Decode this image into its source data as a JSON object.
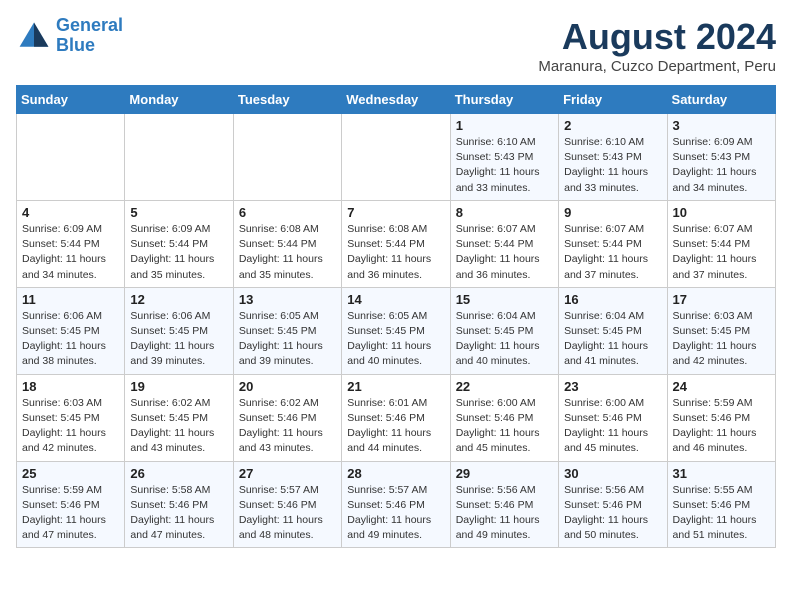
{
  "header": {
    "logo_line1": "General",
    "logo_line2": "Blue",
    "month": "August 2024",
    "location": "Maranura, Cuzco Department, Peru"
  },
  "days_of_week": [
    "Sunday",
    "Monday",
    "Tuesday",
    "Wednesday",
    "Thursday",
    "Friday",
    "Saturday"
  ],
  "weeks": [
    [
      {
        "day": "",
        "info": ""
      },
      {
        "day": "",
        "info": ""
      },
      {
        "day": "",
        "info": ""
      },
      {
        "day": "",
        "info": ""
      },
      {
        "day": "1",
        "info": "Sunrise: 6:10 AM\nSunset: 5:43 PM\nDaylight: 11 hours\nand 33 minutes."
      },
      {
        "day": "2",
        "info": "Sunrise: 6:10 AM\nSunset: 5:43 PM\nDaylight: 11 hours\nand 33 minutes."
      },
      {
        "day": "3",
        "info": "Sunrise: 6:09 AM\nSunset: 5:43 PM\nDaylight: 11 hours\nand 34 minutes."
      }
    ],
    [
      {
        "day": "4",
        "info": "Sunrise: 6:09 AM\nSunset: 5:44 PM\nDaylight: 11 hours\nand 34 minutes."
      },
      {
        "day": "5",
        "info": "Sunrise: 6:09 AM\nSunset: 5:44 PM\nDaylight: 11 hours\nand 35 minutes."
      },
      {
        "day": "6",
        "info": "Sunrise: 6:08 AM\nSunset: 5:44 PM\nDaylight: 11 hours\nand 35 minutes."
      },
      {
        "day": "7",
        "info": "Sunrise: 6:08 AM\nSunset: 5:44 PM\nDaylight: 11 hours\nand 36 minutes."
      },
      {
        "day": "8",
        "info": "Sunrise: 6:07 AM\nSunset: 5:44 PM\nDaylight: 11 hours\nand 36 minutes."
      },
      {
        "day": "9",
        "info": "Sunrise: 6:07 AM\nSunset: 5:44 PM\nDaylight: 11 hours\nand 37 minutes."
      },
      {
        "day": "10",
        "info": "Sunrise: 6:07 AM\nSunset: 5:44 PM\nDaylight: 11 hours\nand 37 minutes."
      }
    ],
    [
      {
        "day": "11",
        "info": "Sunrise: 6:06 AM\nSunset: 5:45 PM\nDaylight: 11 hours\nand 38 minutes."
      },
      {
        "day": "12",
        "info": "Sunrise: 6:06 AM\nSunset: 5:45 PM\nDaylight: 11 hours\nand 39 minutes."
      },
      {
        "day": "13",
        "info": "Sunrise: 6:05 AM\nSunset: 5:45 PM\nDaylight: 11 hours\nand 39 minutes."
      },
      {
        "day": "14",
        "info": "Sunrise: 6:05 AM\nSunset: 5:45 PM\nDaylight: 11 hours\nand 40 minutes."
      },
      {
        "day": "15",
        "info": "Sunrise: 6:04 AM\nSunset: 5:45 PM\nDaylight: 11 hours\nand 40 minutes."
      },
      {
        "day": "16",
        "info": "Sunrise: 6:04 AM\nSunset: 5:45 PM\nDaylight: 11 hours\nand 41 minutes."
      },
      {
        "day": "17",
        "info": "Sunrise: 6:03 AM\nSunset: 5:45 PM\nDaylight: 11 hours\nand 42 minutes."
      }
    ],
    [
      {
        "day": "18",
        "info": "Sunrise: 6:03 AM\nSunset: 5:45 PM\nDaylight: 11 hours\nand 42 minutes."
      },
      {
        "day": "19",
        "info": "Sunrise: 6:02 AM\nSunset: 5:45 PM\nDaylight: 11 hours\nand 43 minutes."
      },
      {
        "day": "20",
        "info": "Sunrise: 6:02 AM\nSunset: 5:46 PM\nDaylight: 11 hours\nand 43 minutes."
      },
      {
        "day": "21",
        "info": "Sunrise: 6:01 AM\nSunset: 5:46 PM\nDaylight: 11 hours\nand 44 minutes."
      },
      {
        "day": "22",
        "info": "Sunrise: 6:00 AM\nSunset: 5:46 PM\nDaylight: 11 hours\nand 45 minutes."
      },
      {
        "day": "23",
        "info": "Sunrise: 6:00 AM\nSunset: 5:46 PM\nDaylight: 11 hours\nand 45 minutes."
      },
      {
        "day": "24",
        "info": "Sunrise: 5:59 AM\nSunset: 5:46 PM\nDaylight: 11 hours\nand 46 minutes."
      }
    ],
    [
      {
        "day": "25",
        "info": "Sunrise: 5:59 AM\nSunset: 5:46 PM\nDaylight: 11 hours\nand 47 minutes."
      },
      {
        "day": "26",
        "info": "Sunrise: 5:58 AM\nSunset: 5:46 PM\nDaylight: 11 hours\nand 47 minutes."
      },
      {
        "day": "27",
        "info": "Sunrise: 5:57 AM\nSunset: 5:46 PM\nDaylight: 11 hours\nand 48 minutes."
      },
      {
        "day": "28",
        "info": "Sunrise: 5:57 AM\nSunset: 5:46 PM\nDaylight: 11 hours\nand 49 minutes."
      },
      {
        "day": "29",
        "info": "Sunrise: 5:56 AM\nSunset: 5:46 PM\nDaylight: 11 hours\nand 49 minutes."
      },
      {
        "day": "30",
        "info": "Sunrise: 5:56 AM\nSunset: 5:46 PM\nDaylight: 11 hours\nand 50 minutes."
      },
      {
        "day": "31",
        "info": "Sunrise: 5:55 AM\nSunset: 5:46 PM\nDaylight: 11 hours\nand 51 minutes."
      }
    ]
  ]
}
